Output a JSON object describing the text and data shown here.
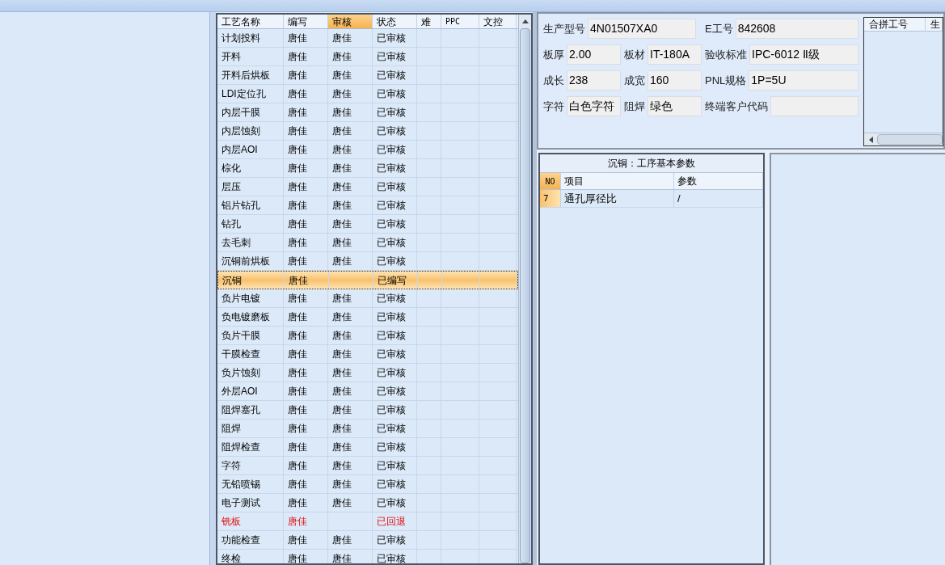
{
  "process_grid": {
    "columns": [
      {
        "label": "工艺名称",
        "selected": false
      },
      {
        "label": "编写",
        "selected": false
      },
      {
        "label": "审核",
        "selected": true
      },
      {
        "label": "状态",
        "selected": false
      },
      {
        "label": "难",
        "selected": false
      },
      {
        "label": "PPC",
        "selected": false
      },
      {
        "label": "文控",
        "selected": false
      }
    ],
    "rows": [
      {
        "cells": [
          "计划投料",
          "唐佳",
          "唐佳",
          "已审核"
        ],
        "selected": false,
        "kind": "normal"
      },
      {
        "cells": [
          "开料",
          "唐佳",
          "唐佳",
          "已审核"
        ],
        "selected": false,
        "kind": "normal"
      },
      {
        "cells": [
          "开料后烘板",
          "唐佳",
          "唐佳",
          "已审核"
        ],
        "selected": false,
        "kind": "normal"
      },
      {
        "cells": [
          "LDI定位孔",
          "唐佳",
          "唐佳",
          "已审核"
        ],
        "selected": false,
        "kind": "normal"
      },
      {
        "cells": [
          "内层干膜",
          "唐佳",
          "唐佳",
          "已审核"
        ],
        "selected": false,
        "kind": "normal"
      },
      {
        "cells": [
          "内层蚀刻",
          "唐佳",
          "唐佳",
          "已审核"
        ],
        "selected": false,
        "kind": "normal"
      },
      {
        "cells": [
          "内层AOI",
          "唐佳",
          "唐佳",
          "已审核"
        ],
        "selected": false,
        "kind": "normal"
      },
      {
        "cells": [
          "棕化",
          "唐佳",
          "唐佳",
          "已审核"
        ],
        "selected": false,
        "kind": "normal"
      },
      {
        "cells": [
          "层压",
          "唐佳",
          "唐佳",
          "已审核"
        ],
        "selected": false,
        "kind": "normal"
      },
      {
        "cells": [
          "铝片钻孔",
          "唐佳",
          "唐佳",
          "已审核"
        ],
        "selected": false,
        "kind": "normal"
      },
      {
        "cells": [
          "钻孔",
          "唐佳",
          "唐佳",
          "已审核"
        ],
        "selected": false,
        "kind": "normal"
      },
      {
        "cells": [
          "去毛刺",
          "唐佳",
          "唐佳",
          "已审核"
        ],
        "selected": false,
        "kind": "normal"
      },
      {
        "cells": [
          "沉铜前烘板",
          "唐佳",
          "唐佳",
          "已审核"
        ],
        "selected": false,
        "kind": "normal"
      },
      {
        "cells": [
          "沉铜",
          "唐佳",
          "",
          "已编写"
        ],
        "selected": true,
        "kind": "normal"
      },
      {
        "cells": [
          "负片电镀",
          "唐佳",
          "唐佳",
          "已审核"
        ],
        "selected": false,
        "kind": "normal"
      },
      {
        "cells": [
          "负电镀磨板",
          "唐佳",
          "唐佳",
          "已审核"
        ],
        "selected": false,
        "kind": "normal"
      },
      {
        "cells": [
          "负片干膜",
          "唐佳",
          "唐佳",
          "已审核"
        ],
        "selected": false,
        "kind": "normal"
      },
      {
        "cells": [
          "干膜检查",
          "唐佳",
          "唐佳",
          "已审核"
        ],
        "selected": false,
        "kind": "normal"
      },
      {
        "cells": [
          "负片蚀刻",
          "唐佳",
          "唐佳",
          "已审核"
        ],
        "selected": false,
        "kind": "normal"
      },
      {
        "cells": [
          "外层AOI",
          "唐佳",
          "唐佳",
          "已审核"
        ],
        "selected": false,
        "kind": "normal"
      },
      {
        "cells": [
          "阻焊塞孔",
          "唐佳",
          "唐佳",
          "已审核"
        ],
        "selected": false,
        "kind": "normal"
      },
      {
        "cells": [
          "阻焊",
          "唐佳",
          "唐佳",
          "已审核"
        ],
        "selected": false,
        "kind": "normal"
      },
      {
        "cells": [
          "阻焊检查",
          "唐佳",
          "唐佳",
          "已审核"
        ],
        "selected": false,
        "kind": "normal"
      },
      {
        "cells": [
          "字符",
          "唐佳",
          "唐佳",
          "已审核"
        ],
        "selected": false,
        "kind": "normal"
      },
      {
        "cells": [
          "无铅喷锡",
          "唐佳",
          "唐佳",
          "已审核"
        ],
        "selected": false,
        "kind": "normal"
      },
      {
        "cells": [
          "电子测试",
          "唐佳",
          "唐佳",
          "已审核"
        ],
        "selected": false,
        "kind": "normal"
      },
      {
        "cells": [
          "铣板",
          "唐佳",
          "",
          "已回退"
        ],
        "selected": false,
        "kind": "returned"
      },
      {
        "cells": [
          "功能检查",
          "唐佳",
          "唐佳",
          "已审核"
        ],
        "selected": false,
        "kind": "normal"
      },
      {
        "cells": [
          "终检",
          "唐佳",
          "唐佳",
          "已审核"
        ],
        "selected": false,
        "kind": "normal"
      }
    ]
  },
  "info_form": {
    "rows": [
      [
        {
          "label": "生产型号",
          "value": "4N01507XA0"
        },
        "",
        {
          "label": "E工号",
          "value": "842608"
        }
      ],
      [
        {
          "label": "板厚",
          "value": "2.00"
        },
        {
          "label": "板材",
          "value": "IT-180A"
        },
        {
          "label": "验收标准",
          "value": "IPC-6012 Ⅱ级"
        }
      ],
      [
        {
          "label": "成长",
          "value": "238"
        },
        {
          "label": "成宽",
          "value": "160"
        },
        {
          "label": "PNL规格",
          "value": "1P=5U"
        }
      ],
      [
        {
          "label": "字符",
          "value": "白色字符"
        },
        {
          "label": "阻焊",
          "value": "绿色"
        },
        {
          "label": "终端客户代码"
        }
      ]
    ]
  },
  "merge_table": {
    "columns": [
      "合拼工号",
      "生"
    ]
  },
  "param_panel": {
    "title": "沉铜：工序基本参数",
    "columns": [
      "NO",
      "项目",
      "参数"
    ],
    "rows": [
      [
        "7",
        "通孔厚径比",
        "/"
      ]
    ]
  }
}
